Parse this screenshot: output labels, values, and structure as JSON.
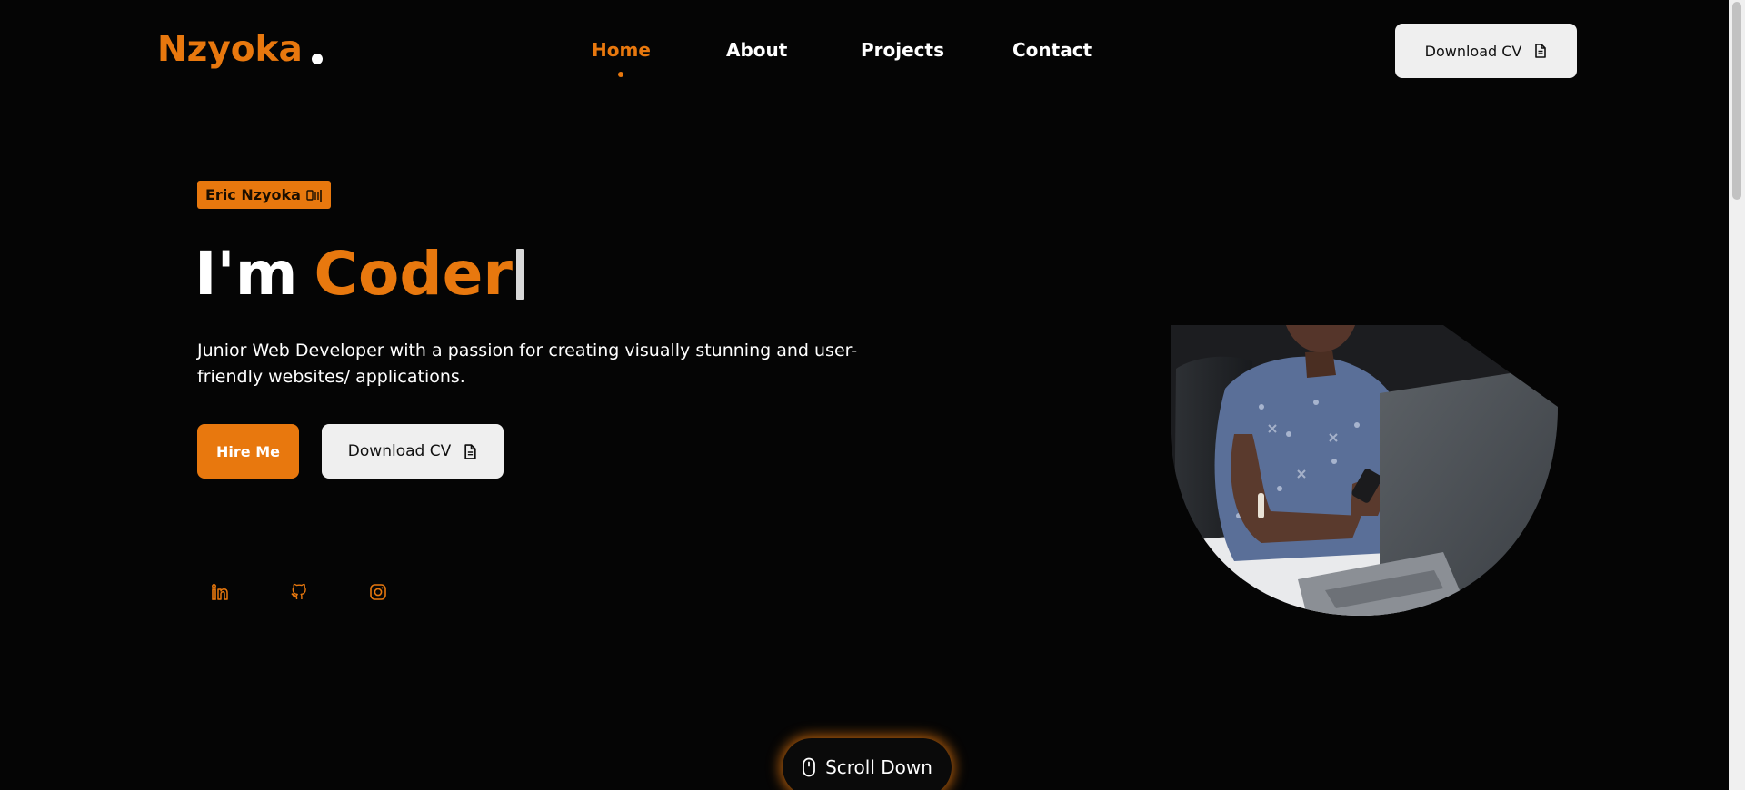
{
  "brand": {
    "logo_text": "Nzyoka",
    "accent_color": "#e8780e"
  },
  "nav": {
    "items": [
      {
        "label": "Home",
        "active": true
      },
      {
        "label": "About",
        "active": false
      },
      {
        "label": "Projects",
        "active": false
      },
      {
        "label": "Contact",
        "active": false
      }
    ]
  },
  "header": {
    "download_cv_label": "Download CV",
    "download_cv_icon": "document-icon"
  },
  "hero": {
    "badge_text": "Eric Nzyoka",
    "badge_icon": "wave-emoji",
    "title_prefix": "I'm",
    "title_typed": "Coder",
    "description": "Junior Web Developer with a passion for creating visually stunning and user-friendly websites/ applications.",
    "hire_label": "Hire Me",
    "download_cv_label": "Download CV"
  },
  "social": [
    {
      "name": "linkedin-icon"
    },
    {
      "name": "github-icon"
    },
    {
      "name": "instagram-icon"
    }
  ],
  "scroll": {
    "label": "Scroll Down",
    "icon": "mouse-icon"
  }
}
